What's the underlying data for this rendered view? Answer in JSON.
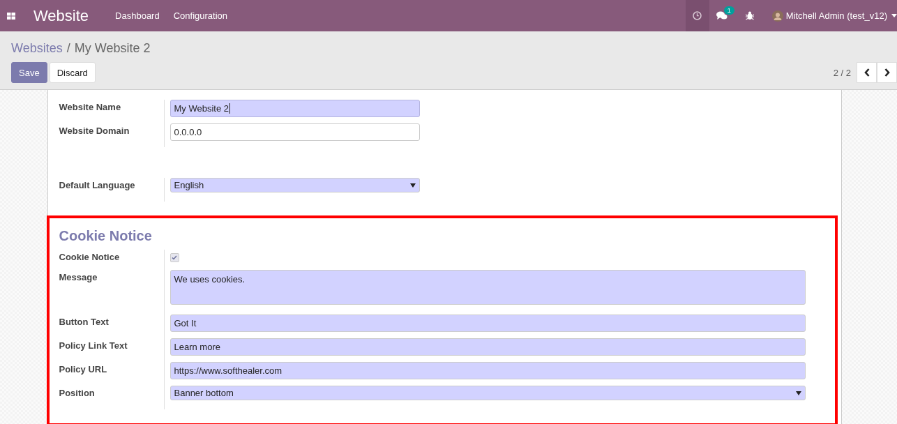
{
  "navbar": {
    "app_title": "Website",
    "menu": [
      "Dashboard",
      "Configuration"
    ],
    "chat_badge": "1",
    "user": "Mitchell Admin (test_v12)"
  },
  "breadcrumb": {
    "parent": "Websites",
    "separator": "/",
    "current": "My Website 2"
  },
  "buttons": [
    {
      "label": "Save",
      "kind": "primary"
    },
    {
      "label": "Discard",
      "kind": "secondary"
    }
  ],
  "pager": {
    "text": "2 / 2"
  },
  "groups": [
    {
      "fields": [
        {
          "label": "Website Name",
          "kind": "text",
          "value": "My Website 2",
          "required": true,
          "focused": true
        },
        {
          "label": "Website Domain",
          "kind": "text",
          "value": "0.0.0.0",
          "required": false,
          "focused": false
        }
      ]
    },
    {
      "fields": [
        {
          "label": "Default Language",
          "kind": "select",
          "value": "English",
          "required": true,
          "focused": false
        }
      ]
    }
  ],
  "highlighted_section": {
    "title": "Cookie Notice",
    "fields": [
      {
        "label": "Cookie Notice",
        "kind": "checkbox",
        "checked": true
      },
      {
        "label": "Message",
        "kind": "textarea",
        "value": "We uses cookies.",
        "required": true
      },
      {
        "label": "Button Text",
        "kind": "text",
        "value": "Got It",
        "required": true
      },
      {
        "label": "Policy Link Text",
        "kind": "text",
        "value": "Learn more",
        "required": true
      },
      {
        "label": "Policy URL",
        "kind": "text",
        "value": "https://www.softhealer.com",
        "required": true
      },
      {
        "label": "Position",
        "kind": "select",
        "value": "Banner bottom",
        "required": true
      }
    ]
  }
}
